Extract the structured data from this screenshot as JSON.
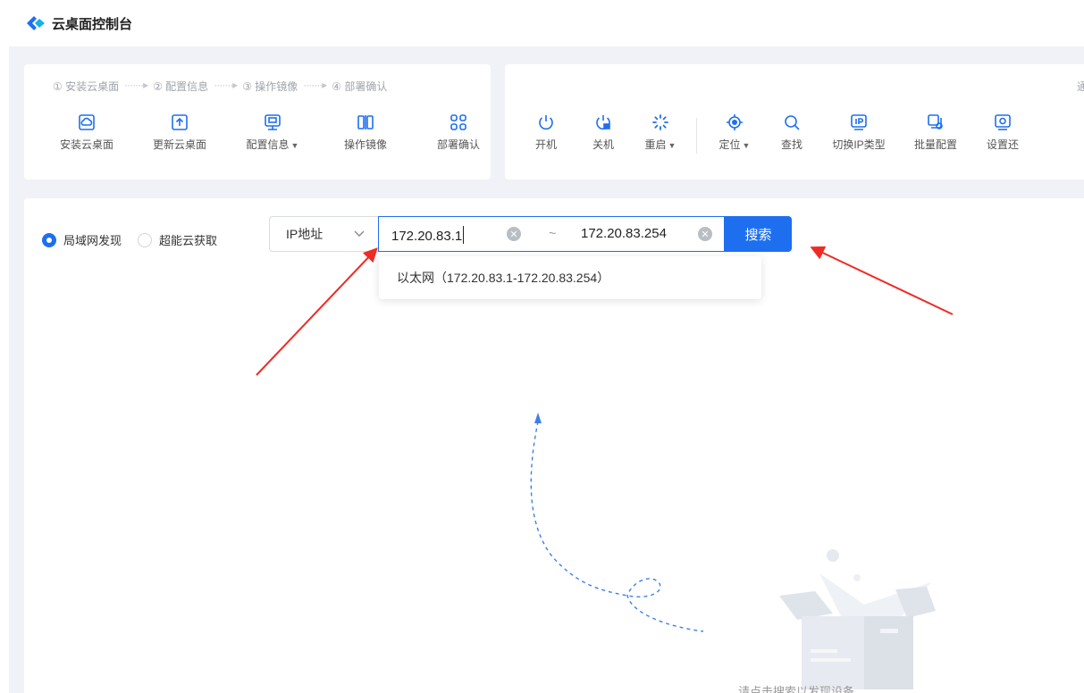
{
  "app": {
    "title": "云桌面控制台",
    "accent": "#1e6ff0"
  },
  "steps": {
    "items": [
      "① 安装云桌面",
      "② 配置信息",
      "③ 操作镜像",
      "④ 部署确认"
    ],
    "arrow": "·······▸"
  },
  "toolbar_left": [
    {
      "label": "安装云桌面",
      "icon": "install-cloud-icon",
      "dropdown": false
    },
    {
      "label": "更新云桌面",
      "icon": "update-upload-icon",
      "dropdown": false
    },
    {
      "label": "配置信息",
      "icon": "monitor-config-icon",
      "dropdown": true
    },
    {
      "label": "操作镜像",
      "icon": "mirror-image-icon",
      "dropdown": false
    },
    {
      "label": "部署确认",
      "icon": "deploy-scan-icon",
      "dropdown": false
    }
  ],
  "toolbar_right": [
    {
      "label": "开机",
      "icon": "power-icon",
      "dropdown": false
    },
    {
      "label": "关机",
      "icon": "shutdown-lock-icon",
      "dropdown": false
    },
    {
      "label": "重启",
      "icon": "restart-spinner-icon",
      "dropdown": true
    },
    {
      "label": "定位",
      "icon": "locate-target-icon",
      "dropdown": true
    },
    {
      "label": "查找",
      "icon": "search-icon",
      "dropdown": false
    },
    {
      "label": "切换IP类型",
      "icon": "ip-switch-icon",
      "dropdown": false
    },
    {
      "label": "批量配置",
      "icon": "batch-config-icon",
      "dropdown": false
    },
    {
      "label": "设置还",
      "icon": "settings-restore-icon",
      "dropdown": false
    }
  ],
  "right_card_label": "通",
  "search": {
    "radio_options": [
      {
        "label": "局域网发现",
        "checked": true
      },
      {
        "label": "超能云获取",
        "checked": false
      }
    ],
    "select_value": "IP地址",
    "ip_start": "172.20.83.1",
    "ip_separator": "~",
    "ip_end": "172.20.83.254",
    "button_label": "搜索",
    "suggestion": "以太网（172.20.83.1-172.20.83.254）"
  },
  "empty_state": {
    "text": "请点击搜索以发现设备"
  }
}
